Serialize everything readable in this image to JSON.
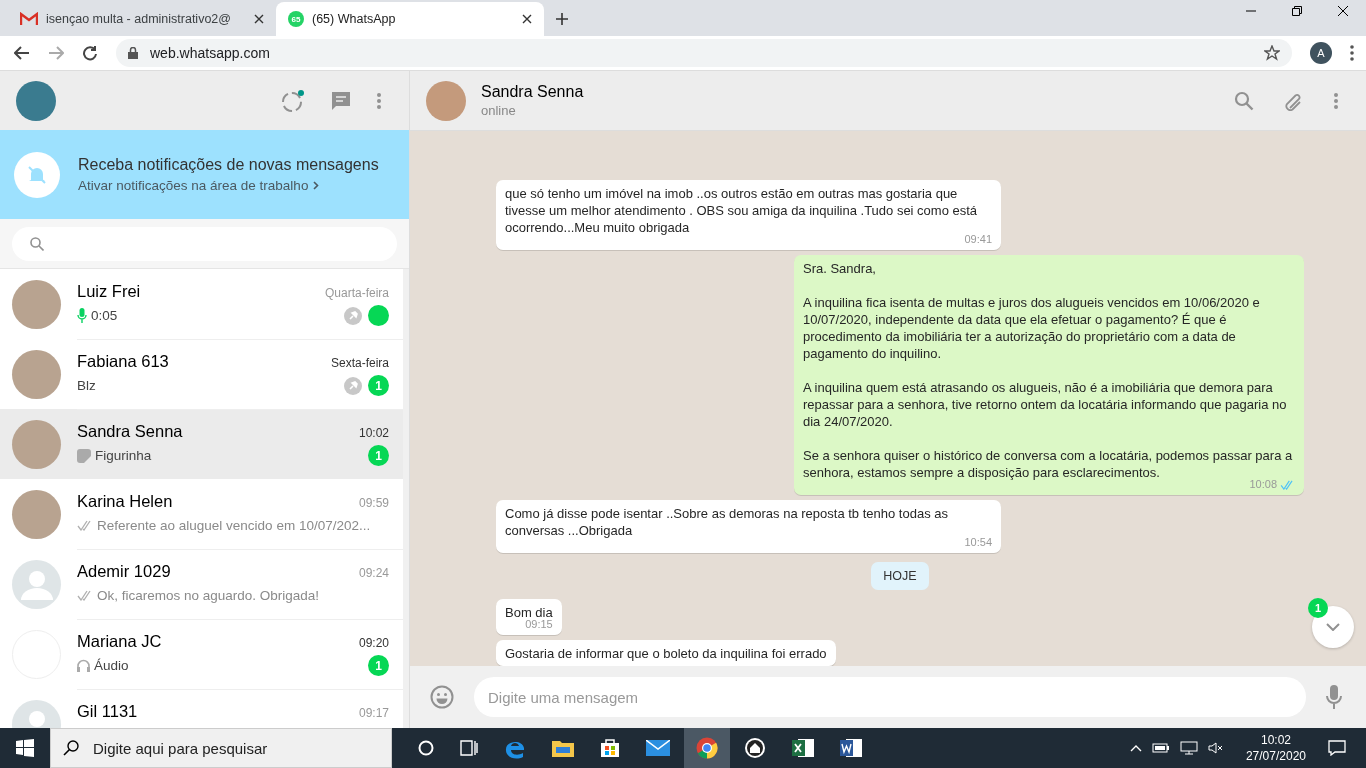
{
  "browser": {
    "tabs": [
      {
        "title": "isençao multa - administrativo2@",
        "selected": false
      },
      {
        "title": "(65) WhatsApp",
        "badge": "65",
        "selected": true
      }
    ],
    "url": "web.whatsapp.com",
    "profile": "A"
  },
  "sidebar": {
    "banner": {
      "title": "Receba notificações de novas mensagens",
      "link": "Ativar notificações na área de trabalho"
    },
    "chats": [
      {
        "name": "Luiz Frei",
        "time": "Quarta-feira",
        "preview": "0:05",
        "kind": "voice",
        "pinned": true,
        "unread": true,
        "selected": false
      },
      {
        "name": "Fabiana 613",
        "time": "Sexta-feira",
        "preview": "Blz",
        "kind": "text",
        "pinned": true,
        "unread": true,
        "unread_count": "1",
        "selected": false
      },
      {
        "name": "Sandra Senna",
        "time": "10:02",
        "preview": "Figurinha",
        "kind": "sticker",
        "pinned": false,
        "unread": true,
        "unread_count": "1",
        "selected": true
      },
      {
        "name": "Karina Helen",
        "time": "09:59",
        "preview": "Referente ao aluguel vencido em 10/07/202...",
        "kind": "sent",
        "pinned": false,
        "unread": false,
        "selected": false
      },
      {
        "name": "Ademir 1029",
        "time": "09:24",
        "preview": "Ok, ficaremos no aguardo.   Obrigada!",
        "kind": "sent",
        "pinned": false,
        "unread": false,
        "selected": false
      },
      {
        "name": "Mariana JC",
        "time": "09:20",
        "preview": "Áudio",
        "kind": "audio",
        "pinned": false,
        "unread": true,
        "unread_count": "1",
        "selected": false
      },
      {
        "name": "Gil 1131",
        "time": "09:17",
        "kind": "text",
        "pinned": false,
        "unread": false,
        "selected": false
      }
    ]
  },
  "conversation": {
    "name": "Sandra Senna",
    "status": "online",
    "messages": [
      {
        "kind": "in",
        "paragraphs": [
          "que só tenho um imóvel na imob ..os outros estão em outras mas gostaria que tivesse um melhor atendimento  . OBS sou amiga da inquilina .Tudo sei como está ocorrendo...Meu muito obrigada"
        ],
        "time": "09:41"
      },
      {
        "kind": "out",
        "paragraphs": [
          "Sra. Sandra,",
          "A inquilina fica isenta de multas e juros dos alugueis vencidos em 10/06/2020 e 10/07/2020, independente da data que ela efetuar o pagamento? É que é procedimento da imobiliária ter a autorização do proprietário com a data de pagamento do inquilino.",
          "A inquilina quem está atrasando os alugueis, não é a imobiliária que demora para repassar para a senhora, tive retorno ontem da locatária informando que pagaria no dia 24/07/2020.",
          "Se a senhora quiser o histórico de conversa com a locatária, podemos passar para a senhora, estamos sempre a disposição para esclarecimentos."
        ],
        "time": "10:08",
        "read": true
      },
      {
        "kind": "in",
        "paragraphs": [
          "Como já disse pode isentar ..Sobre as demoras na reposta tb tenho todas as conversas ...Obrigada"
        ],
        "time": "10:54"
      },
      {
        "kind": "date",
        "paragraphs": [
          "HOJE"
        ]
      },
      {
        "kind": "in",
        "paragraphs": [
          "Bom dia"
        ],
        "time": "09:15"
      },
      {
        "kind": "in",
        "paragraphs": [
          "Gostaria de informar que o boleto da inquilina foi errado"
        ]
      }
    ],
    "scroll_badge": "1",
    "composer": {
      "placeholder": "Digite uma mensagem"
    }
  },
  "taskbar": {
    "search_placeholder": "Digite aqui para pesquisar",
    "time": "10:02",
    "date": "27/07/2020"
  }
}
